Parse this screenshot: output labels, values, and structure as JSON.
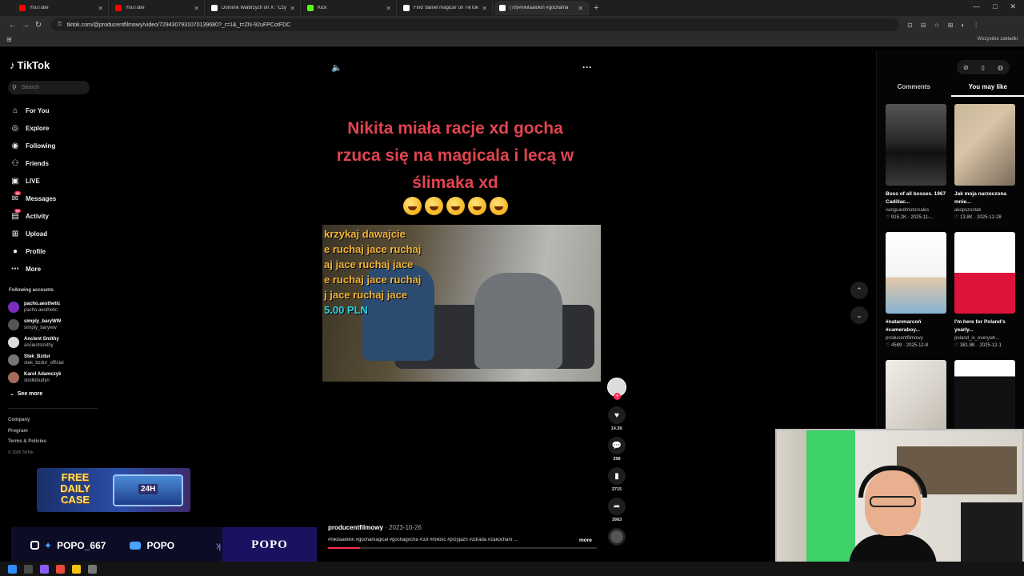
{
  "browser": {
    "tabs": [
      {
        "title": "YouTube",
        "favicon_color": "#ff0000",
        "active": false
      },
      {
        "title": "YouTube",
        "favicon_color": "#ff0000",
        "active": false
      },
      {
        "title": "Dominik Wałbrzych on X: \"Czy",
        "favicon_color": "#ffffff",
        "active": false
      },
      {
        "title": "Kick",
        "favicon_color": "#53fc18",
        "active": false
      },
      {
        "title": "Find 'daniel magical' on TikTok",
        "favicon_color": "#ffffff",
        "active": false
      },
      {
        "title": "(78)#nikitaalokin #gochama",
        "favicon_color": "#ffffff",
        "active": true
      }
    ],
    "url": "tiktok.com/@producentfilmowy/video/7294307931070139680?_r=1&_t=ZN-92uFPCotFDC",
    "bookmarks_label": "Wszystkie zakładki"
  },
  "sidebar": {
    "logo": "TikTok",
    "search_placeholder": "Search",
    "nav": [
      {
        "label": "For You",
        "icon": "home-icon",
        "glyph": "⌂"
      },
      {
        "label": "Explore",
        "icon": "compass-icon",
        "glyph": "◎"
      },
      {
        "label": "Following",
        "icon": "following-icon",
        "glyph": "◉"
      },
      {
        "label": "Friends",
        "icon": "friends-icon",
        "glyph": "⚇"
      },
      {
        "label": "LIVE",
        "icon": "live-icon",
        "glyph": "▣"
      },
      {
        "label": "Messages",
        "icon": "messages-icon",
        "glyph": "✉",
        "badge": "99"
      },
      {
        "label": "Activity",
        "icon": "activity-icon",
        "glyph": "▤",
        "badge": "99"
      },
      {
        "label": "Upload",
        "icon": "upload-icon",
        "glyph": "⊞"
      },
      {
        "label": "Profile",
        "icon": "profile-icon",
        "glyph": "●"
      },
      {
        "label": "More",
        "icon": "more-icon",
        "glyph": "⋯"
      }
    ],
    "following_title": "Following accounts",
    "following": [
      {
        "name": "pacho.aesthetic",
        "handle": "pacho.aesthetic",
        "color": "#7b2cbf"
      },
      {
        "name": "simply_baryWW",
        "handle": "simply_baryww",
        "color": "#555555"
      },
      {
        "name": "Ancient Smithy",
        "handle": "ancientsmithy",
        "color": "#dddddd"
      },
      {
        "name": "Stek_Bzdur",
        "handle": "stek_bzdur_official",
        "color": "#777777"
      },
      {
        "name": "Karol Adamczyk",
        "handle": "slodkibudyn",
        "color": "#a36b5a"
      }
    ],
    "see_more": "See more",
    "footer": [
      "Company",
      "Program",
      "Terms & Policies"
    ],
    "copyright": "© 2026 TikTok"
  },
  "overlay": {
    "case_banner": "FREE DAILY CASE",
    "twitter_handle": "POPO_667",
    "youtube_handle": "POPO",
    "brand": "POPO"
  },
  "video": {
    "caption": "Nikita miała racje xd gocha rzuca się na magicala i lecą w ślimaka xd",
    "frame_text": [
      "krzykaj dawajcie",
      "e ruchaj jace ruchaj",
      "aj jace ruchaj jace",
      "e ruchaj jace ruchaj",
      "j jace ruchaj jace"
    ],
    "frame_price": "5.00 PLN",
    "likes": "14.3K",
    "comments": "398",
    "saves": "2715",
    "shares": "3983",
    "author": "producentfilmowy",
    "date": "2023-10-26",
    "description": "#nikitaalokin #gochamagical #gochagocha #3zł #miłość #przyjaźń #zdrada #zakochani ...",
    "more_label": "more",
    "progress": 0.12
  },
  "right_panel": {
    "tabs": [
      "Comments",
      "You may like"
    ],
    "active_tab": "You may like",
    "videos": [
      {
        "title": "Boss of all bosses. 1967 Cadillac...",
        "author": "vanguardmotorsales",
        "likes": "915.2K",
        "date": "2025-11-...",
        "thumb": "car"
      },
      {
        "title": "Jak moja narzeczona mnie...",
        "author": "akopszostak",
        "likes": "13.8K",
        "date": "2025-12-28",
        "thumb": "couple"
      },
      {
        "title": "#natanmarcoń #cameraboy...",
        "author": "producentfilmowy",
        "likes": "4589",
        "date": "2025-12-8",
        "thumb": "text"
      },
      {
        "title": "I'm here for Poland's yearly...",
        "author": "poland_is_everywh...",
        "likes": "381.8K",
        "date": "2025-12-1",
        "thumb": "flag"
      },
      {
        "title": "",
        "author": "",
        "likes": "",
        "date": "",
        "thumb": "dancer"
      },
      {
        "title": "",
        "author": "",
        "likes": "",
        "date": "",
        "thumb": "grid"
      }
    ]
  }
}
